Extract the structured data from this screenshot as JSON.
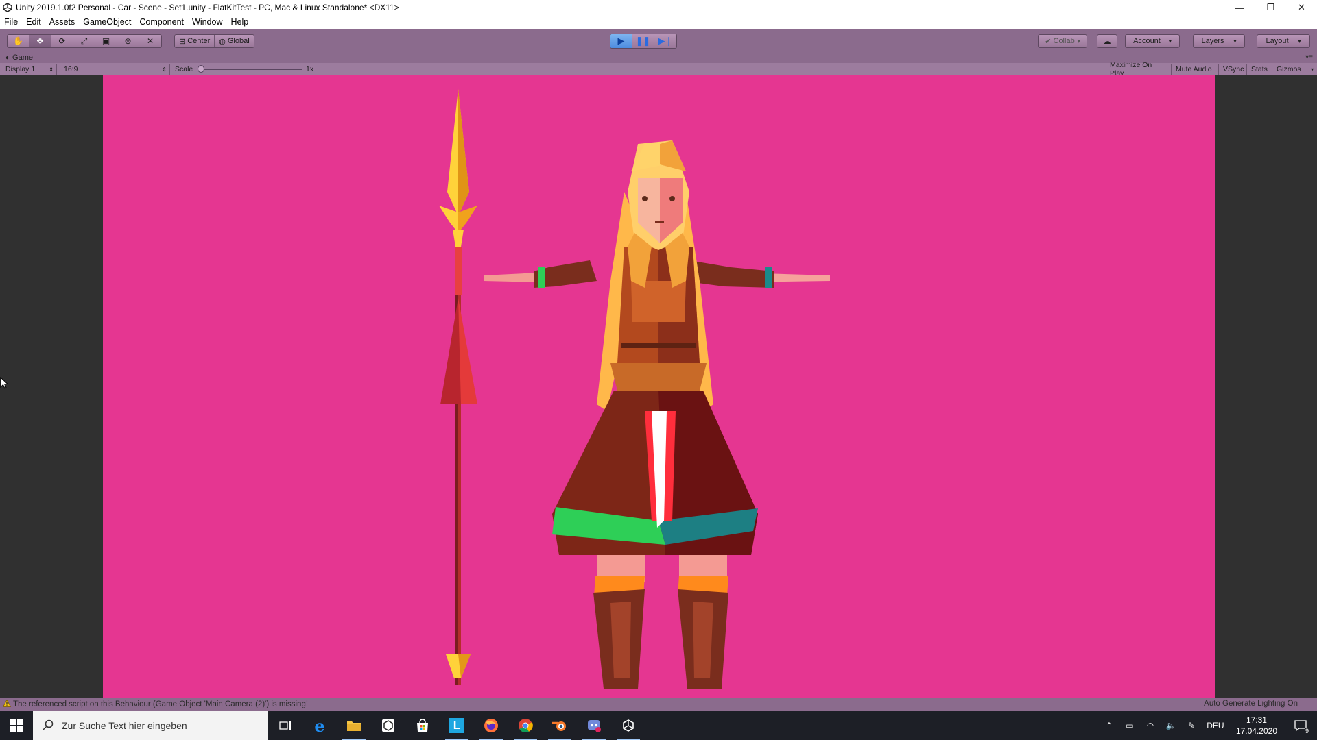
{
  "window": {
    "title": "Unity 2019.1.0f2 Personal - Car - Scene - Set1.unity - FlatKitTest - PC, Mac & Linux Standalone* <DX11>",
    "controls": [
      "—",
      "❐",
      "✕"
    ]
  },
  "menu": [
    "File",
    "Edit",
    "Assets",
    "GameObject",
    "Component",
    "Window",
    "Help"
  ],
  "toolbar": {
    "tools": [
      "hand",
      "move",
      "rotate",
      "scale",
      "rect",
      "transform",
      "custom"
    ],
    "pivot_mode": "Center",
    "pivot_rotation": "Global",
    "collab": "Collab",
    "account": "Account",
    "layers": "Layers",
    "layout": "Layout"
  },
  "game": {
    "tab_label": "Game",
    "display": "Display 1",
    "aspect": "16:9",
    "scale_label": "Scale",
    "scale_value": "1x",
    "toggles": [
      "Maximize On Play",
      "Mute Audio",
      "VSync",
      "Stats",
      "Gizmos"
    ]
  },
  "status": {
    "message": "The referenced script on this Behaviour (Game Object 'Main Camera (2)') is missing!",
    "right_text": "Auto Generate Lighting On"
  },
  "taskbar": {
    "search_placeholder": "Zur Suche Text hier eingeben",
    "apps": [
      "task-view",
      "edge",
      "file-explorer",
      "unity-hub",
      "store",
      "libre",
      "firefox",
      "chrome",
      "blender",
      "discord",
      "unity"
    ],
    "language": "DEU",
    "time": "17:31",
    "date": "17.04.2020",
    "notifications": "9"
  },
  "colors": {
    "toolbar_bg": "#8b6b8d",
    "game_bg": "#e53691",
    "viewport_bg": "#303030"
  }
}
